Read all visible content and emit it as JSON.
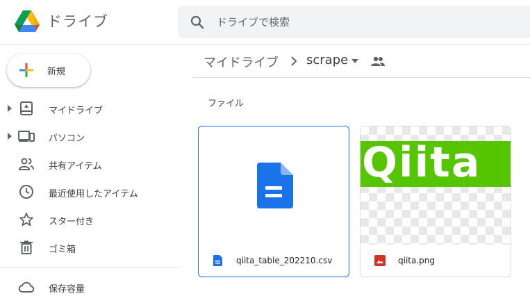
{
  "header": {
    "app_title": "ドライブ",
    "search_placeholder": "ドライブで検索"
  },
  "sidebar": {
    "new_label": "新規",
    "items": [
      {
        "label": "マイドライブ",
        "icon": "my-drive-icon"
      },
      {
        "label": "パソコン",
        "icon": "computer-icon"
      },
      {
        "label": "共有アイテム",
        "icon": "shared-icon"
      },
      {
        "label": "最近使用したアイテム",
        "icon": "clock-icon"
      },
      {
        "label": "スター付き",
        "icon": "star-icon"
      },
      {
        "label": "ゴミ箱",
        "icon": "trash-icon"
      },
      {
        "label": "保存容量",
        "icon": "cloud-icon"
      }
    ]
  },
  "breadcrumb": {
    "root": "マイドライブ",
    "current": "scrape"
  },
  "files_section": {
    "label": "ファイル",
    "files": [
      {
        "name": "qiita_table_202210.csv",
        "type": "document"
      },
      {
        "name": "qiita.png",
        "type": "image",
        "preview_text": "Qiita"
      }
    ]
  },
  "colors": {
    "accent": "#1a73e8",
    "qiita_green": "#55c500",
    "image_red": "#d93025"
  }
}
